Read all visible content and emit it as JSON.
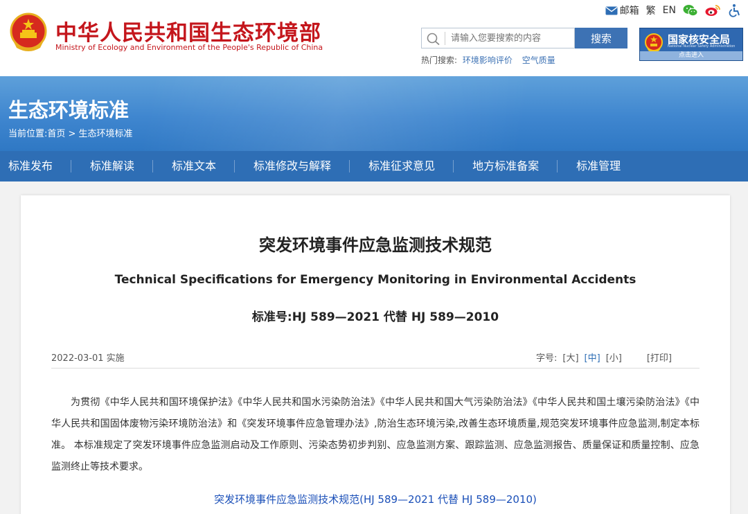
{
  "header": {
    "site_title": "中华人民共和国生态环境部",
    "site_subtitle": "Ministry of Ecology and Environment of the People's Republic of China",
    "top_links": {
      "mail": "邮箱",
      "traditional": "繁",
      "english": "EN"
    },
    "search": {
      "placeholder": "请输入您要搜索的内容",
      "button": "搜索",
      "hot_label": "热门搜索:",
      "hot_items": [
        "环境影响评价",
        "空气质量"
      ]
    },
    "nnsa": {
      "title": "国家核安全局",
      "subtitle": "National Nuclear Safety Administration",
      "enter": "点击进入"
    }
  },
  "banner": {
    "title": "生态环境标准",
    "breadcrumb": "当前位置:首页 > 生态环境标准"
  },
  "nav": {
    "tabs": [
      "标准发布",
      "标准解读",
      "标准文本",
      "标准修改与解释",
      "标准征求意见",
      "地方标准备案",
      "标准管理"
    ]
  },
  "article": {
    "title": "突发环境事件应急监测技术规范",
    "title_en": "Technical Specifications for Emergency Monitoring in Environmental Accidents",
    "standard_no": "标准号:HJ 589—2021 代替 HJ 589—2010",
    "date": "2022-03-01 实施",
    "font_size_label": "字号:",
    "font_large": "[大]",
    "font_medium": "[中]",
    "font_small": "[小]",
    "print": "[打印]",
    "body": "为贯彻《中华人民共和国环境保护法》《中华人民共和国水污染防治法》《中华人民共和国大气污染防治法》《中华人民共和国土壤污染防治法》《中华人民共和国固体废物污染环境防治法》和《突发环境事件应急管理办法》,防治生态环境污染,改善生态环境质量,规范突发环境事件应急监测,制定本标准。 本标准规定了突发环境事件应急监测启动及工作原则、污染态势初步判别、应急监测方案、跟踪监测、应急监测报告、质量保证和质量控制、应急监测终止等技术要求。",
    "link": "突发环境事件应急监测技术规范(HJ 589—2021 代替 HJ 589—2010)"
  },
  "colors": {
    "brand_red": "#c4161c",
    "nav_blue": "#2e6eb5",
    "link_blue": "#1a4fb8"
  },
  "icons": [
    "national-emblem-icon",
    "mail-icon",
    "wechat-icon",
    "weibo-icon",
    "accessibility-icon",
    "search-icon"
  ]
}
